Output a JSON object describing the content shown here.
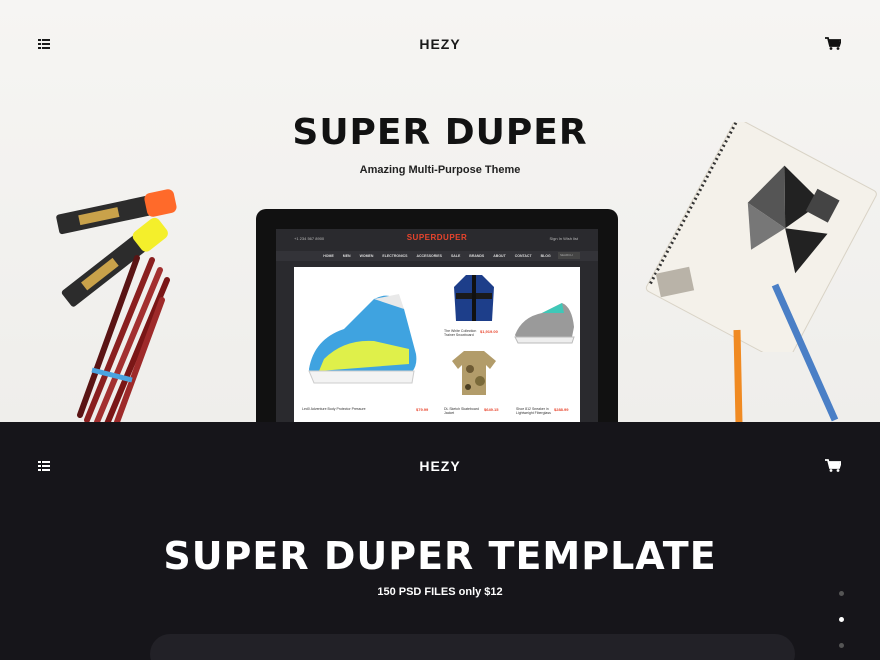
{
  "hero": {
    "brand": "HEZY",
    "title": "SUPER DUPER",
    "subtitle": "Amazing Multi-Purpose Theme",
    "tablet": {
      "phone": "+1 234 567 8900",
      "logo": "SUPERDUPER",
      "login": "Sign In   Wish list",
      "menu": [
        "HOME",
        "MEN",
        "WOMEN",
        "ELECTRONICS",
        "ACCESSORIES",
        "SALE",
        "BRANDS",
        "ABOUT",
        "CONTACT",
        "BLOG"
      ],
      "search_placeholder": "SEARCH",
      "products": [
        {
          "name": "Led0 Adventure Body Protector Pressure",
          "price": "$79.99"
        },
        {
          "name": "The White Collection Trainer Snowboard",
          "price": "$1,919.00"
        },
        {
          "name": "DL Sketch Skateboard Jacket",
          "price": "$649.15"
        },
        {
          "name": "Shoe 812 Sneaker in Lightweight Fiberglass",
          "price": "$288.99"
        }
      ]
    }
  },
  "dark": {
    "brand": "HEZY",
    "title": "SUPER DUPER TEMPLATE",
    "subtitle": "150 PSD FILES only $12"
  },
  "pagination": {
    "count": 3,
    "active_index": 1
  },
  "icons": {
    "menu": "list-menu-icon",
    "cart": "shopping-cart-icon"
  },
  "colors": {
    "accent": "#e8442c",
    "dark_bg": "#16151a",
    "hero_bg": "#f2f1ee"
  }
}
